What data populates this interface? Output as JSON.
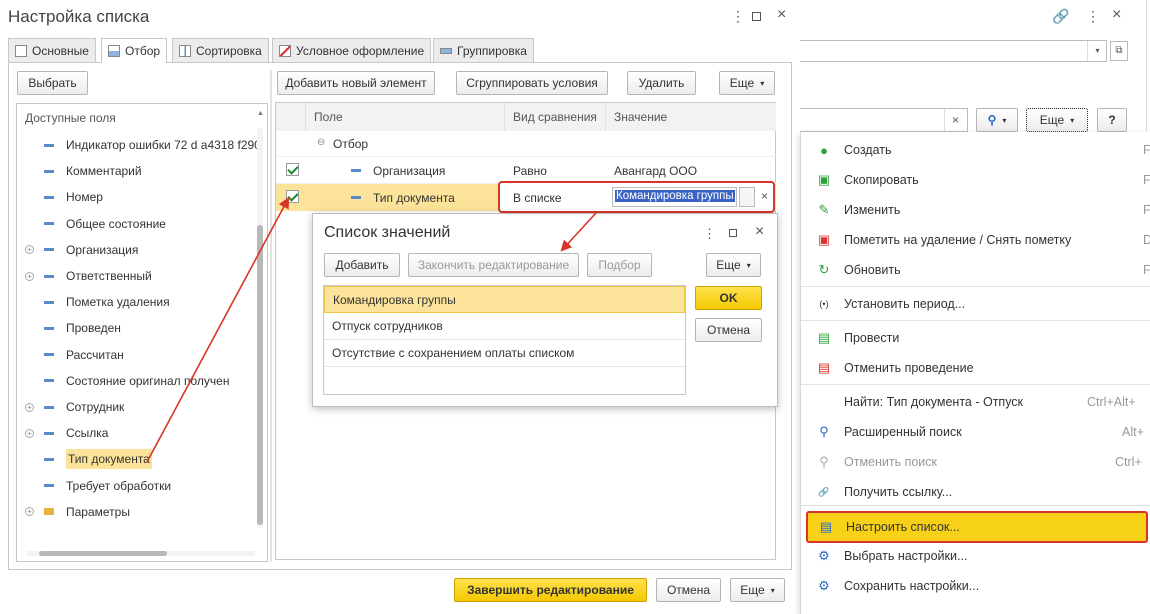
{
  "window": {
    "title": "Настройка списка"
  },
  "tabs": [
    {
      "label": "Основные",
      "icon": "document-icon"
    },
    {
      "label": "Отбор",
      "icon": "filter-icon"
    },
    {
      "label": "Сортировка",
      "icon": "sort-icon"
    },
    {
      "label": "Условное оформление",
      "icon": "format-icon"
    },
    {
      "label": "Группировка",
      "icon": "group-icon"
    }
  ],
  "left_panel": {
    "select_button": "Выбрать",
    "header": "Доступные поля",
    "fields": [
      {
        "label": "Индикатор ошибки 72 d a4318 f290",
        "expandable": false
      },
      {
        "label": "Комментарий",
        "expandable": false
      },
      {
        "label": "Номер",
        "expandable": false
      },
      {
        "label": "Общее состояние",
        "expandable": false
      },
      {
        "label": "Организация",
        "expandable": true
      },
      {
        "label": "Ответственный",
        "expandable": true
      },
      {
        "label": "Пометка удаления",
        "expandable": false
      },
      {
        "label": "Проведен",
        "expandable": false
      },
      {
        "label": "Рассчитан",
        "expandable": false
      },
      {
        "label": "Состояние оригинал получен",
        "expandable": false
      },
      {
        "label": "Сотрудник",
        "expandable": true
      },
      {
        "label": "Ссылка",
        "expandable": true
      },
      {
        "label": "Тип документа",
        "expandable": false,
        "highlighted": true
      },
      {
        "label": "Требует обработки",
        "expandable": false
      },
      {
        "label": "Параметры",
        "expandable": true,
        "folder": true
      }
    ]
  },
  "filter_toolbar": {
    "add_new": "Добавить новый элемент",
    "group_conditions": "Сгруппировать условия",
    "delete": "Удалить",
    "more": "Еще"
  },
  "filter_grid": {
    "columns": [
      "Поле",
      "Вид сравнения",
      "Значение"
    ],
    "group_label": "Отбор",
    "rows": [
      {
        "field": "Организация",
        "comparison": "Равно",
        "value": "Авангард ООО",
        "checked": true
      },
      {
        "field": "Тип документа",
        "comparison": "В списке",
        "value": "Командировка группы",
        "checked": true
      }
    ],
    "ellipsis": "...",
    "clear": "×"
  },
  "value_list_dialog": {
    "title": "Список значений",
    "add": "Добавить",
    "finish_editing": "Закончить редактирование",
    "pick": "Подбор",
    "more": "Еще",
    "ok": "OK",
    "cancel": "Отмена",
    "items": [
      "Командировка группы",
      "Отпуск сотрудников",
      "Отсутствие с сохранением оплаты списком"
    ]
  },
  "footer": {
    "finish_editing": "Завершить редактирование",
    "cancel": "Отмена",
    "more": "Еще"
  },
  "right_toolbar": {
    "more": "Еще",
    "help": "?",
    "clear": "×"
  },
  "context_menu": [
    {
      "label": "Создать",
      "icon": "plus-circle-icon",
      "shortcut": "F"
    },
    {
      "label": "Скопировать",
      "icon": "copy-icon",
      "shortcut": "F"
    },
    {
      "label": "Изменить",
      "icon": "pencil-icon",
      "shortcut": "F"
    },
    {
      "label": "Пометить на удаление / Снять пометку",
      "icon": "delete-mark-icon",
      "shortcut": "D"
    },
    {
      "label": "Обновить",
      "icon": "refresh-icon",
      "shortcut": "F"
    },
    {
      "label": "Установить период...",
      "icon": "period-icon",
      "shortcut": ""
    },
    {
      "label": "Провести",
      "icon": "post-icon",
      "shortcut": ""
    },
    {
      "label": "Отменить проведение",
      "icon": "unpost-icon",
      "shortcut": ""
    },
    {
      "label": "Найти: Тип документа - Отпуск",
      "icon": "",
      "shortcut": "Ctrl+Alt+"
    },
    {
      "label": "Расширенный поиск",
      "icon": "search-icon",
      "shortcut": "Alt+"
    },
    {
      "label": "Отменить поиск",
      "icon": "cancel-search-icon",
      "shortcut": "Ctrl+",
      "disabled": true
    },
    {
      "label": "Получить ссылку...",
      "icon": "link-icon",
      "shortcut": ""
    },
    {
      "label": "Настроить список...",
      "icon": "settings-list-icon",
      "shortcut": "",
      "highlighted": true
    },
    {
      "label": "Выбрать настройки...",
      "icon": "choose-settings-icon",
      "shortcut": ""
    },
    {
      "label": "Сохранить настройки...",
      "icon": "save-settings-icon",
      "shortcut": ""
    }
  ],
  "colors": {
    "accent_yellow": "#f7d117",
    "highlight_border": "#d9342b",
    "selection_blue": "#3a63c6",
    "row_yellow": "#fbe39a"
  }
}
